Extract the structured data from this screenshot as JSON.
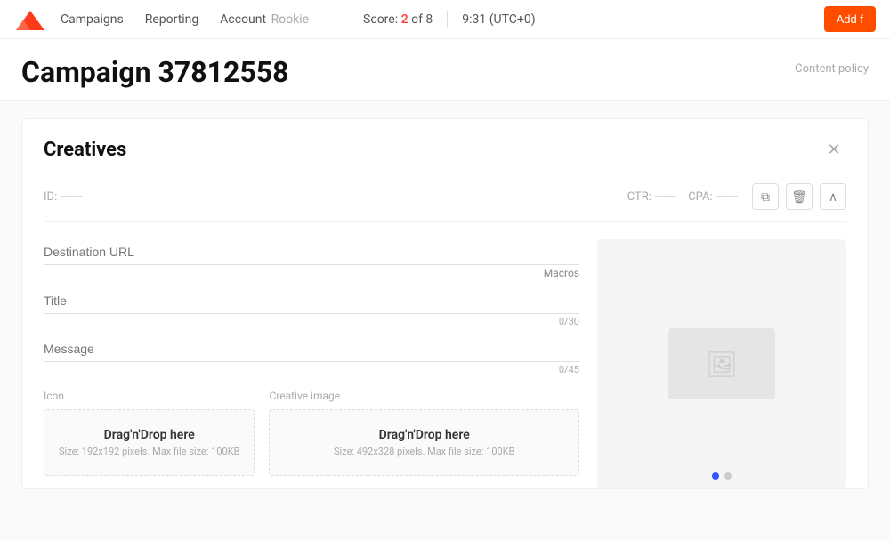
{
  "header": {
    "nav_campaigns": "Campaigns",
    "nav_reporting": "Reporting",
    "nav_account": "Account",
    "nav_account_sub": "Rookie",
    "score_label": "Score:",
    "score_current": "2",
    "score_total": "8",
    "time": "9:31 (UTC+0)",
    "add_button": "Add f"
  },
  "page": {
    "title": "Campaign 37812558",
    "content_policy": "Content policy"
  },
  "creatives": {
    "title": "Creatives",
    "id_label": "ID:",
    "id_value": "-------",
    "ctr_label": "CTR:",
    "ctr_value": "-------",
    "cpa_label": "CPA:",
    "cpa_value": "-------",
    "destination_url_placeholder": "Destination URL",
    "macros_label": "Macros",
    "title_field_placeholder": "Title",
    "title_char_count": "0/30",
    "message_placeholder": "Message",
    "message_char_count": "0/45",
    "icon_label": "Icon",
    "icon_drag_text": "Drag'n'Drop here",
    "icon_size_text": "Size: 192x192 pixels. Max file size: 100KB",
    "creative_image_label": "Creative image",
    "creative_image_drag_text": "Drag'n'Drop here",
    "creative_image_size_text": "Size: 492x328 pixels. Max file size: 100KB"
  }
}
